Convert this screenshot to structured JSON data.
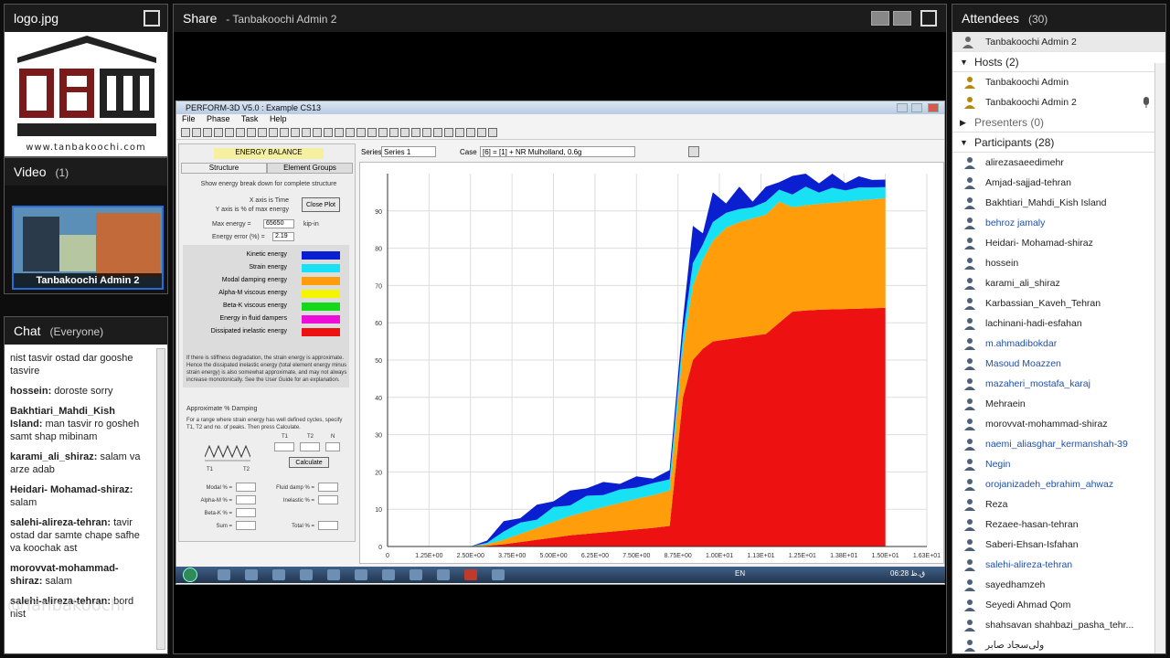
{
  "logo_pod": {
    "title": "logo.jpg",
    "url": "www.tanbakoochi.com"
  },
  "video_pod": {
    "title": "Video",
    "count": "(1)",
    "participant": "Tanbakoochi Admin 2"
  },
  "chat_pod": {
    "title": "Chat",
    "scope": "(Everyone)",
    "messages": [
      {
        "who": "",
        "text": "nist  tasvir ostad dar gooshe tasvire"
      },
      {
        "who": "hossein:",
        "text": " doroste sorry"
      },
      {
        "who": "Bakhtiari_Mahdi_Kish Island:",
        "text": " man tasvir ro gosheh samt shap mibinam"
      },
      {
        "who": "karami_ali_shiraz:",
        "text": " salam va arze adab"
      },
      {
        "who": "Heidari- Mohamad-shiraz:",
        "text": " salam"
      },
      {
        "who": "salehi-alireza-tehran:",
        "text": " tavir ostad dar samte chape safhe va koochak ast"
      },
      {
        "who": "morovvat-mohammad-shiraz:",
        "text": " salam"
      },
      {
        "who": "salehi-alireza-tehran:",
        "text": " bord nist"
      }
    ]
  },
  "watermark": "@Tanbakoochi",
  "share_pod": {
    "title": "Share",
    "presenter": "- Tanbakoochi Admin 2"
  },
  "app": {
    "title": "PERFORM-3D V5.0 : Example CS13",
    "menu": [
      "File",
      "Phase",
      "Task",
      "Help"
    ],
    "energy_title": "ENERGY BALANCE",
    "tabs": [
      "Structure",
      "Element Groups"
    ],
    "subtitle": "Show energy break down for complete structure",
    "x_axis_text": "X axis is Time",
    "y_axis_text": "Y axis is % of max energy",
    "close_plot": "Close Plot",
    "max_energy_label": "Max energy =",
    "max_energy_value": "65650",
    "max_energy_unit": "kip-in",
    "energy_error_label": "Energy error (%) =",
    "energy_error_value": "2.19",
    "legend": [
      {
        "label": "Kinetic energy",
        "color": "#0a1fd0"
      },
      {
        "label": "Strain energy",
        "color": "#17e1f3"
      },
      {
        "label": "Modal damping energy",
        "color": "#ff9d0a"
      },
      {
        "label": "Alpha-M viscous energy",
        "color": "#f5f500"
      },
      {
        "label": "Beta-K viscous energy",
        "color": "#16d81a"
      },
      {
        "label": "Energy in fluid dampers",
        "color": "#f00cd8"
      },
      {
        "label": "Dissipated inelastic energy",
        "color": "#ee1111"
      }
    ],
    "note": "If there is stiffness degradation, the strain energy is approximate. Hence the dissipated inelastic energy (total element energy minus strain energy) is also somewhat approximate, and may not always increase monotonically. See the User Guide for an explanation.",
    "approx_title": "Approximate % Damping",
    "approx_text": "For a range where strain energy has well defined cycles, specify T1, T2 and no. of peaks. Then press Calculate.",
    "t1": "T1",
    "t2": "T2",
    "n": "N",
    "calc": "Calculate",
    "damp_labels": [
      "Modal % =",
      "Alpha-M % =",
      "Beta-K % =",
      "Sum ="
    ],
    "damp_labels2": [
      "Fluid damp % =",
      "Inelastic % =",
      "Total % ="
    ],
    "series_label": "Series",
    "series_value": "Series 1",
    "case_label": "Case",
    "case_value": "[6] = [1] + NR Mulholland, 0.6g"
  },
  "taskbar": {
    "lang": "EN",
    "time": "06:28 ق.ظ"
  },
  "attendees": {
    "title": "Attendees",
    "count": "(30)",
    "me": "Tanbakoochi Admin 2",
    "hosts_label": "Hosts (2)",
    "hosts": [
      "Tanbakoochi Admin",
      "Tanbakoochi Admin 2"
    ],
    "presenters_label": "Presenters (0)",
    "participants_label": "Participants (28)",
    "participants": [
      {
        "name": "alirezasaeedimehr",
        "blue": false
      },
      {
        "name": "Amjad-sajjad-tehran",
        "blue": false
      },
      {
        "name": "Bakhtiari_Mahdi_Kish Island",
        "blue": false
      },
      {
        "name": "behroz jamaly",
        "blue": true
      },
      {
        "name": "Heidari- Mohamad-shiraz",
        "blue": false
      },
      {
        "name": "hossein",
        "blue": false
      },
      {
        "name": "karami_ali_shiraz",
        "blue": false
      },
      {
        "name": "Karbassian_Kaveh_Tehran",
        "blue": false
      },
      {
        "name": "lachinani-hadi-esfahan",
        "blue": false
      },
      {
        "name": "m.ahmadibokdar",
        "blue": true
      },
      {
        "name": "Masoud Moazzen",
        "blue": true
      },
      {
        "name": "mazaheri_mostafa_karaj",
        "blue": true
      },
      {
        "name": "Mehraein",
        "blue": false
      },
      {
        "name": "morovvat-mohammad-shiraz",
        "blue": false
      },
      {
        "name": "naemi_aliasghar_kermanshah-39",
        "blue": true
      },
      {
        "name": "Negin",
        "blue": true
      },
      {
        "name": "orojanizadeh_ebrahim_ahwaz",
        "blue": true
      },
      {
        "name": "Reza",
        "blue": false
      },
      {
        "name": "Rezaee-hasan-tehran",
        "blue": false
      },
      {
        "name": "Saberi-Ehsan-Isfahan",
        "blue": false
      },
      {
        "name": "salehi-alireza-tehran",
        "blue": true
      },
      {
        "name": "sayedhamzeh",
        "blue": false
      },
      {
        "name": "Seyedi Ahmad Qom",
        "blue": false
      },
      {
        "name": "shahsavan shahbazi_pasha_tehr...",
        "blue": false
      },
      {
        "name": "ولی‌سجاد صابر",
        "blue": false
      }
    ]
  },
  "chart_data": {
    "type": "area",
    "title": "",
    "xlabel": "",
    "ylabel": "",
    "x_ticks": [
      "0",
      "1.25E+00",
      "2.50E+00",
      "3.75E+00",
      "5.00E+00",
      "6.25E+00",
      "7.50E+00",
      "8.75E+00",
      "1.00E+01",
      "1.13E+01",
      "1.25E+01",
      "1.38E+01",
      "1.50E+01",
      "1.63E+01"
    ],
    "y_ticks": [
      "0",
      "10",
      "20",
      "30",
      "40",
      "50",
      "60",
      "70",
      "80",
      "90"
    ],
    "xlim": [
      0,
      16.25
    ],
    "ylim": [
      0,
      100
    ],
    "x": [
      0,
      1.25,
      2.5,
      3.0,
      3.5,
      4.0,
      4.5,
      5.0,
      5.5,
      6.0,
      6.5,
      7.0,
      7.5,
      8.0,
      8.5,
      8.9,
      9.2,
      9.5,
      9.8,
      10.2,
      10.6,
      11.0,
      11.4,
      11.8,
      12.2,
      12.6,
      13.0,
      13.4,
      13.8,
      14.2,
      14.6,
      15.0
    ],
    "series": [
      {
        "name": "Dissipated inelastic energy",
        "color": "#ee1111",
        "values": [
          0,
          0,
          0,
          0.2,
          0.6,
          1.2,
          1.8,
          2.4,
          3.0,
          3.4,
          3.8,
          4.2,
          4.6,
          5.0,
          5.5,
          40,
          50,
          53,
          55,
          55.5,
          56,
          56.5,
          57,
          60,
          63,
          63.3,
          63.5,
          63.6,
          63.7,
          63.8,
          63.9,
          64
        ]
      },
      {
        "name": "Modal damping energy",
        "color": "#ff9d0a",
        "values": [
          0,
          0,
          0,
          0.4,
          1.2,
          2.2,
          3.2,
          4.2,
          5.2,
          6.0,
          6.8,
          7.5,
          8.2,
          8.8,
          9.5,
          13,
          20,
          24,
          27,
          30,
          31,
          31.5,
          32,
          32.5,
          28,
          28.2,
          28.4,
          28.6,
          28.8,
          29.0,
          29.2,
          29.4
        ]
      },
      {
        "name": "Strain energy",
        "color": "#17e1f3",
        "values": [
          0,
          0,
          0,
          0.4,
          2.2,
          3.0,
          2.2,
          4.0,
          2.8,
          4.2,
          3.2,
          3.6,
          3.0,
          3.2,
          3.0,
          3.8,
          6.0,
          4.0,
          5.0,
          4.0,
          3.5,
          3.0,
          3.5,
          3.2,
          3.4,
          5.0,
          3.0,
          4.0,
          3.0,
          3.5,
          3.2,
          3.0
        ]
      },
      {
        "name": "Kinetic energy",
        "color": "#0a1fd0",
        "values": [
          0,
          0,
          0,
          0.6,
          2.8,
          1.2,
          4.0,
          1.5,
          4.0,
          2.0,
          3.5,
          1.5,
          3.0,
          1.2,
          2.5,
          4.0,
          10.0,
          3.0,
          8.0,
          2.5,
          6.0,
          1.5,
          4.0,
          2.0,
          5.0,
          8.0,
          2.5,
          4.0,
          2.0,
          3.0,
          2.0,
          2.0
        ]
      }
    ]
  }
}
